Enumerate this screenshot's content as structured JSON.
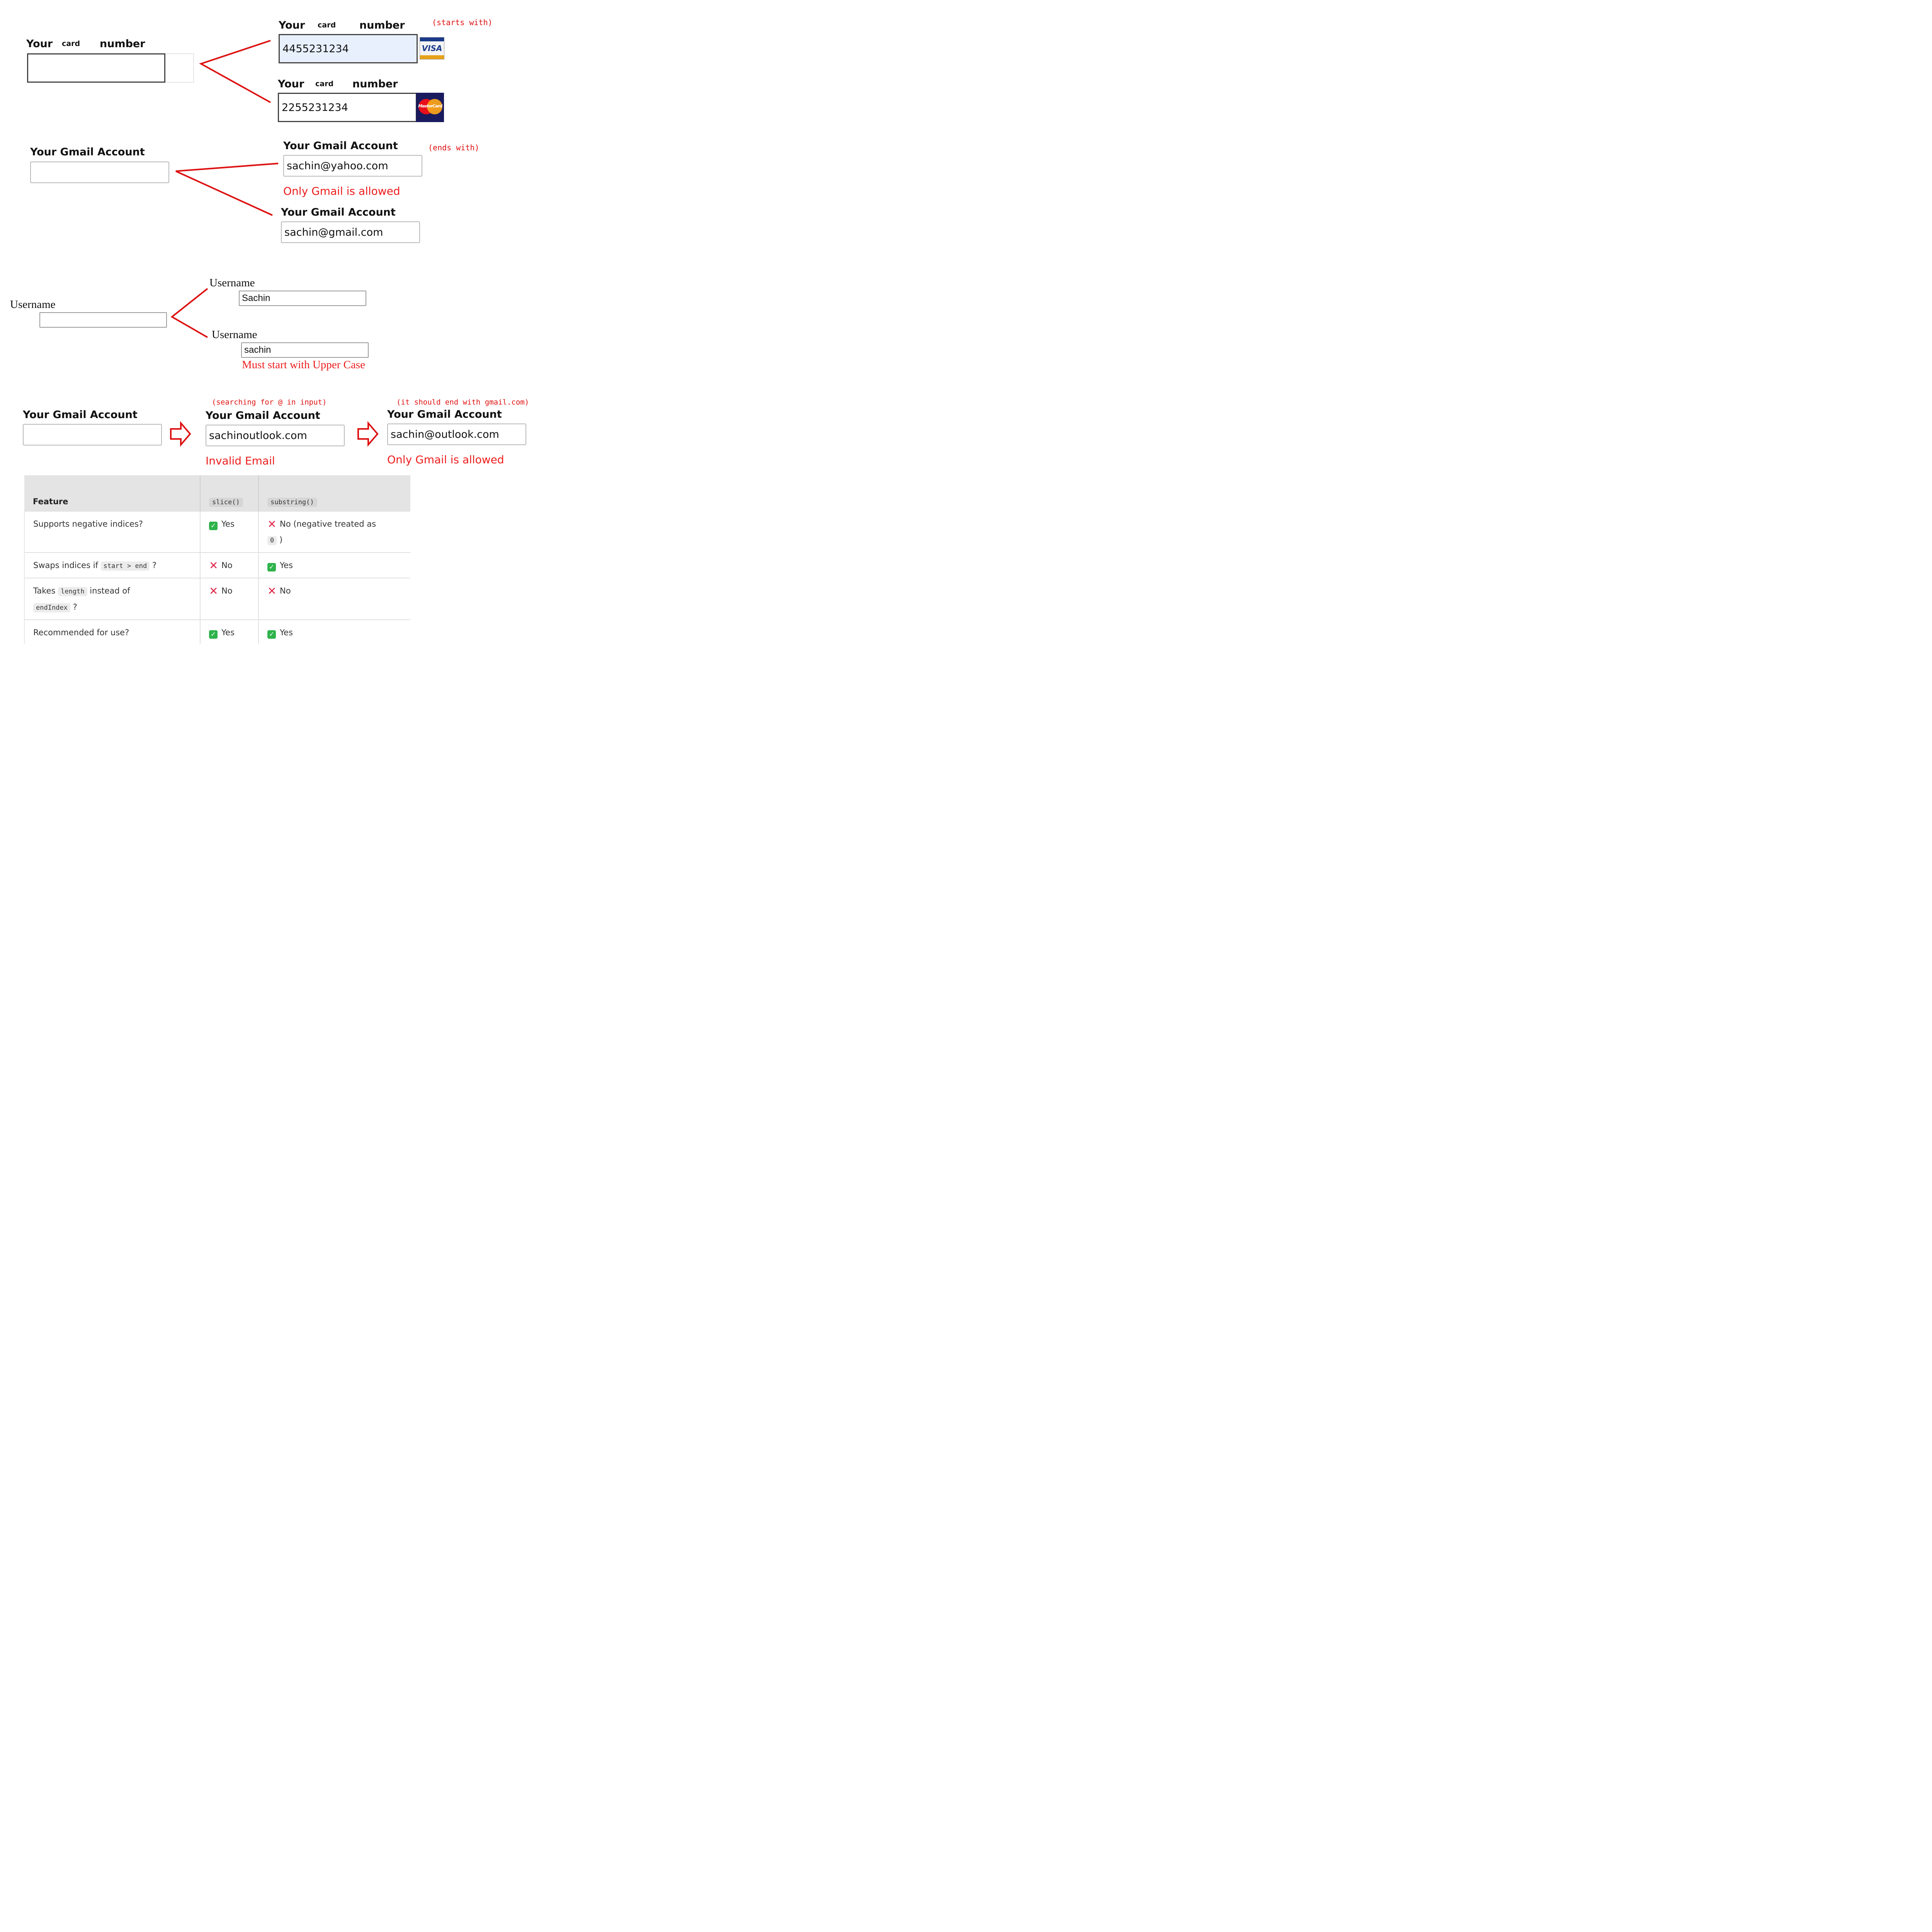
{
  "card": {
    "label_your": "Your",
    "label_card": "card",
    "label_number": "number",
    "note": "(starts with)",
    "visa_value": "4455231234",
    "mastercard_value": "2255231234",
    "visa_logo": "VISA",
    "mastercard_logo": "MasterCard"
  },
  "gmail_ends": {
    "label": "Your Gmail Account",
    "note": "(ends with)",
    "bad_value": "sachin@yahoo.com",
    "error": "Only Gmail is allowed",
    "good_value": "sachin@gmail.com"
  },
  "username": {
    "label": "Username",
    "good_value": "Sachin",
    "bad_value": "sachin",
    "error": "Must start with Upper Case"
  },
  "gmail_flow": {
    "label": "Your Gmail Account",
    "note_at": "(searching for @ in input)",
    "note_end": "(it should end with gmail.com)",
    "value_no_at": "sachinoutlook.com",
    "error_invalid": "Invalid Email",
    "value_outlook": "sachin@outlook.com",
    "error_gmail": "Only Gmail is allowed",
    "arrow_icon": "outline-right-arrow"
  },
  "table": {
    "headers": [
      "Feature",
      "slice()",
      "substring()"
    ],
    "rows": [
      {
        "feature": "Supports negative indices?",
        "slice": "Yes",
        "substring": "No (negative treated as",
        "substring_code": "0",
        "substring_tail": ")"
      },
      {
        "feature_pre": "Swaps indices if",
        "feature_code": "start > end",
        "feature_post": "?",
        "slice": "No",
        "substring": "Yes"
      },
      {
        "feature_pre": "Takes",
        "feature_code": "length",
        "feature_mid": "instead of",
        "feature_code2": "endIndex",
        "feature_post": "?",
        "slice": "No",
        "substring": "No"
      },
      {
        "feature": "Recommended for use?",
        "slice": "Yes",
        "substring": "Yes"
      }
    ],
    "status_colors": {
      "yes": "#2db34a",
      "no": "#e0264a"
    }
  },
  "colors": {
    "accent_red": "#e01010"
  }
}
